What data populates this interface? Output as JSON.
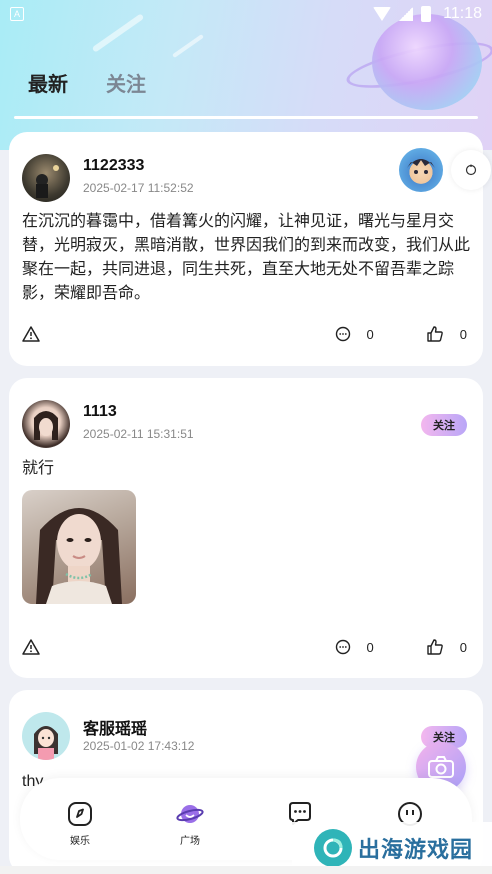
{
  "status_bar": {
    "time": "11:18"
  },
  "tabs": [
    {
      "label": "最新",
      "active": true
    },
    {
      "label": "关注",
      "active": false
    }
  ],
  "posts": [
    {
      "username": "1122333",
      "time": "2025-02-17 11:52:52",
      "text": "在沉沉的暮霭中，借着篝火的闪耀，让神见证，曙光与星月交替，光明寂灭，黑暗消散，世界因我们的到来而改变，我们从此聚在一起，共同进退，同生共死，直至大地无处不留吾辈之踪影，荣耀即吾命。",
      "comments": "0",
      "likes": "0"
    },
    {
      "username": "1113",
      "time": "2025-02-11 15:31:51",
      "text": "就行",
      "follow_label": "关注",
      "comments": "0",
      "likes": "0"
    },
    {
      "username": "客服瑶瑶",
      "time": "2025-01-02 17:43:12",
      "text": "thy",
      "follow_label": "关注"
    }
  ],
  "bottom_nav": [
    {
      "label": "娱乐",
      "icon": "compass-icon"
    },
    {
      "label": "广场",
      "icon": "planet-icon"
    },
    {
      "label": "",
      "icon": "chat-bubble-icon"
    },
    {
      "label": "",
      "icon": "profile-face-icon"
    }
  ],
  "watermark": {
    "text": "出海游戏园"
  },
  "colors": {
    "accent_gradient_start": "#f3b7ee",
    "accent_gradient_end": "#b9a6f7"
  }
}
